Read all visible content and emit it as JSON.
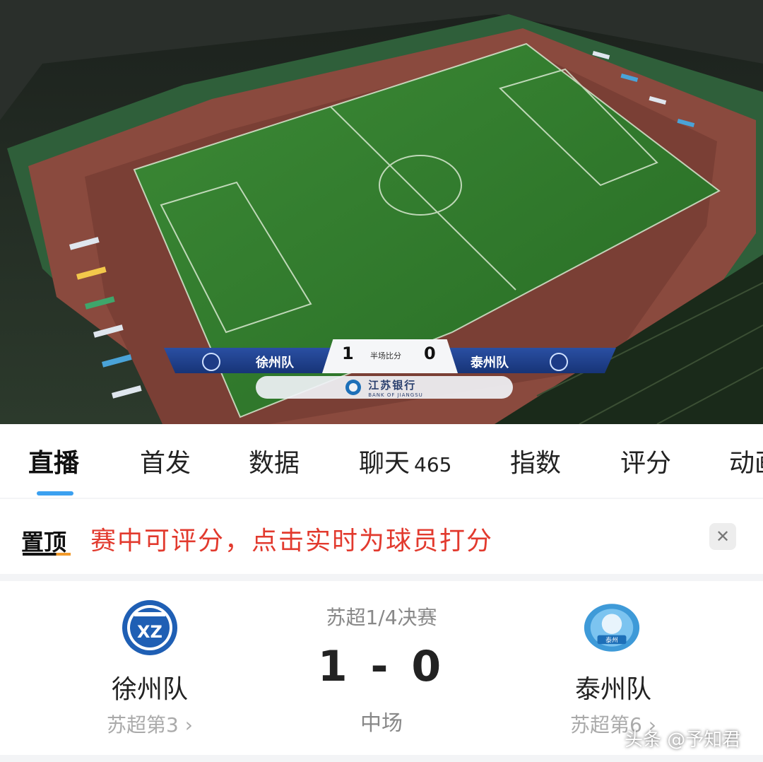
{
  "broadcast": {
    "home_team": "徐州队",
    "away_team": "泰州队",
    "home_score": "1",
    "away_score": "0",
    "period_label": "半场比分",
    "sponsor_name": "江苏银行",
    "sponsor_sub": "BANK OF JIANGSU"
  },
  "tabs": [
    {
      "label": "直播",
      "active": true
    },
    {
      "label": "首发"
    },
    {
      "label": "数据"
    },
    {
      "label": "聊天",
      "count": "465"
    },
    {
      "label": "指数"
    },
    {
      "label": "评分"
    },
    {
      "label": "动画"
    }
  ],
  "notice": {
    "tag": "置顶",
    "text": "赛中可评分，点击实时为球员打分",
    "close_icon": "close-icon"
  },
  "match": {
    "competition": "苏超1/4决赛",
    "score": "1 - 0",
    "status": "中场",
    "home": {
      "name": "徐州队",
      "rank": "苏超第3 ›",
      "logo": "xuzhou-crest-icon"
    },
    "away": {
      "name": "泰州队",
      "rank": "苏超第6 ›",
      "logo": "taizhou-crest-icon"
    }
  },
  "watermark": "头条 @予知君",
  "colors": {
    "accent": "#3ba0f0",
    "notice_red": "#e23a2e",
    "pitch_green": "#2f7d2c",
    "track": "#8a4a3e"
  }
}
